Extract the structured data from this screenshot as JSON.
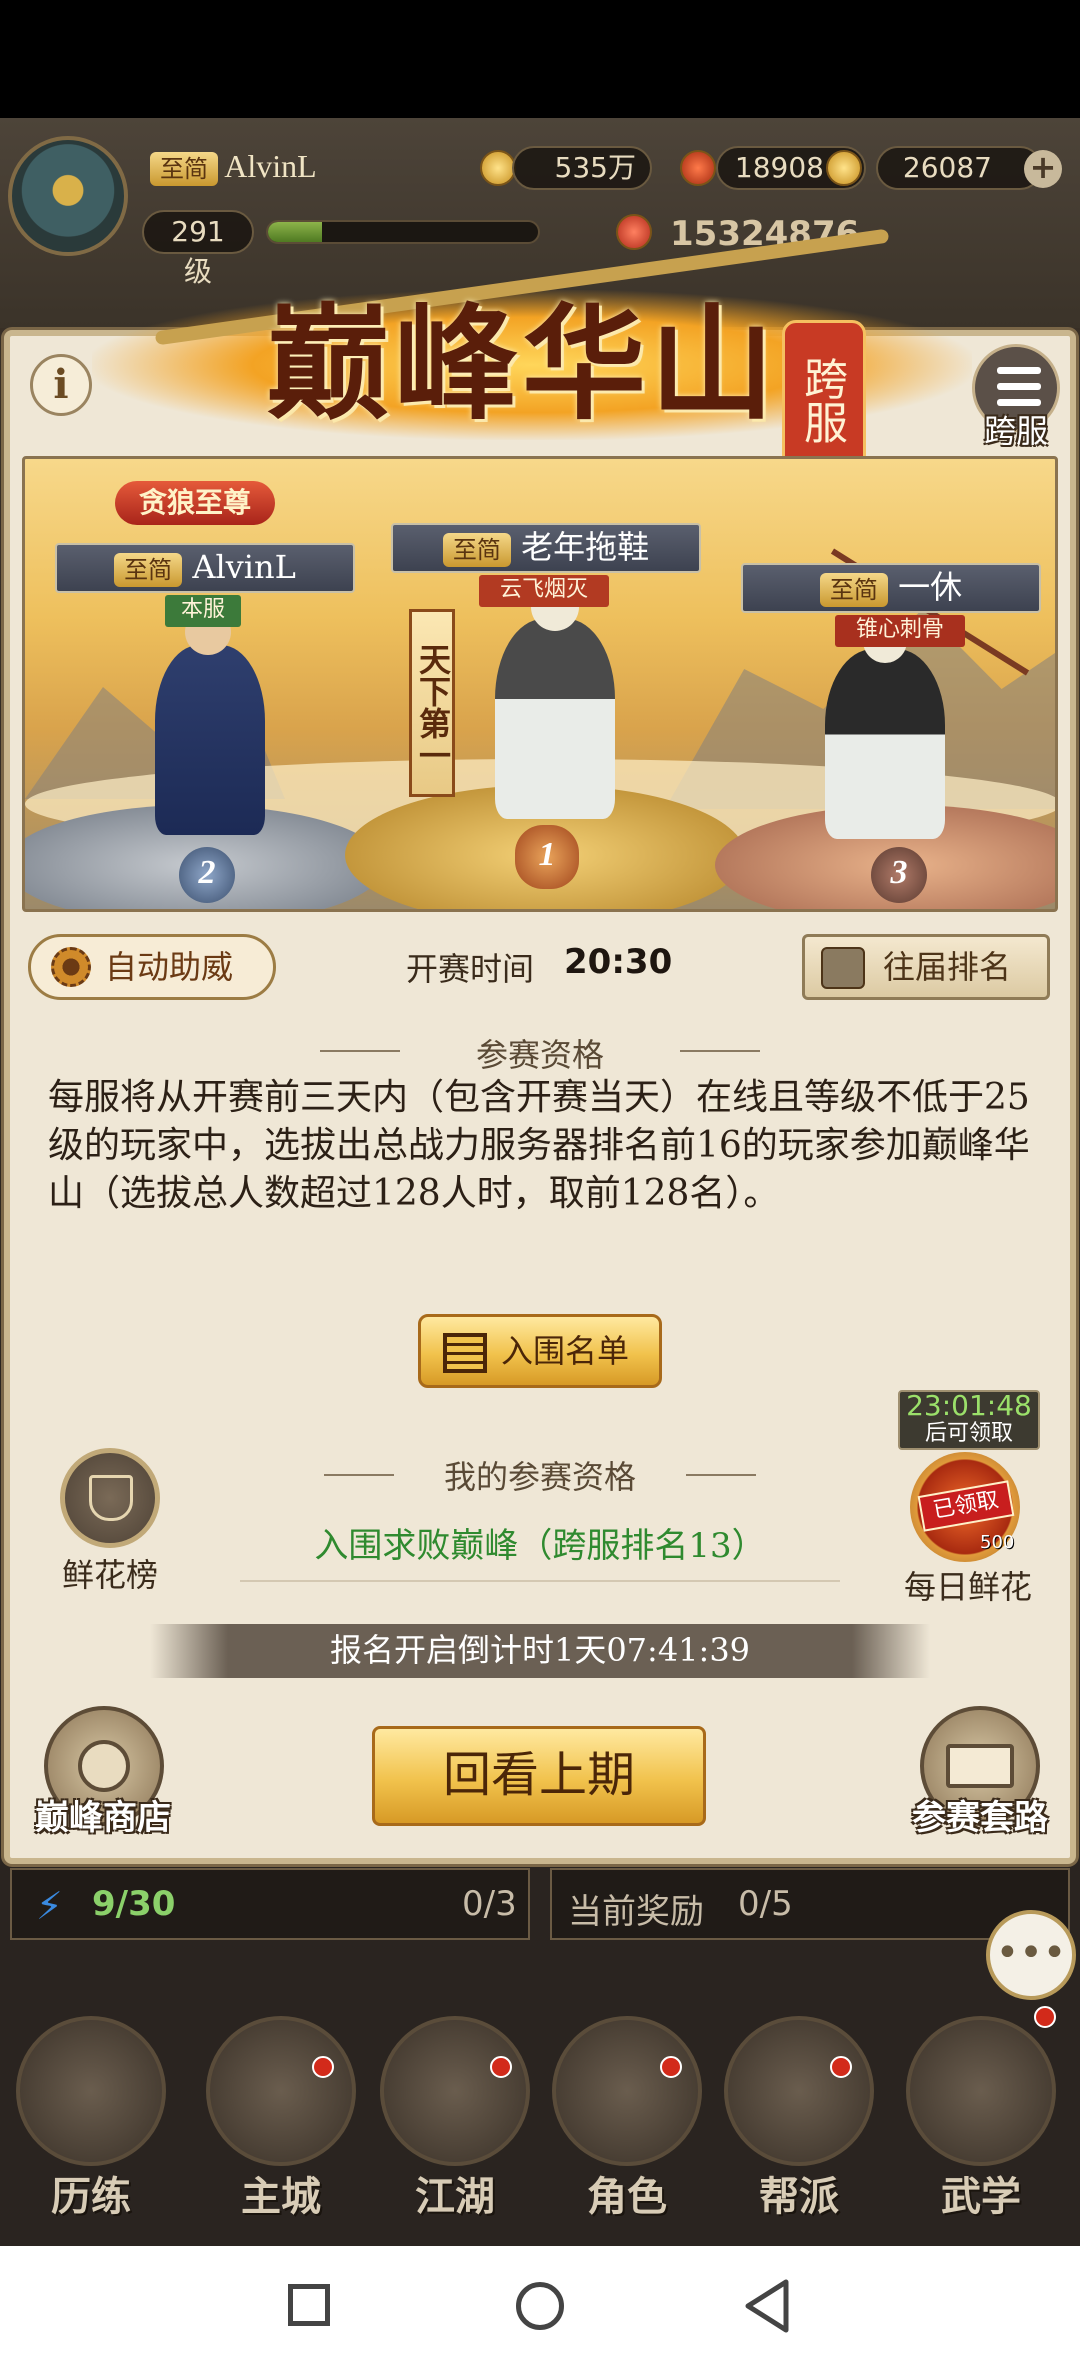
{
  "top_bar": {
    "vip_tag": "至简",
    "player_name": "AlvinL",
    "level": "291级",
    "level_progress": 0.2,
    "coins": "535万",
    "tokens": "18908",
    "gold": "26087",
    "power": "15324876"
  },
  "header": {
    "title": "巅峰华山",
    "seal_text": "跨服",
    "info_label": "i",
    "cross_server_label": "跨服"
  },
  "podium": {
    "banner_text": "天下第一",
    "title_badge": "贪狼至尊",
    "rank1": {
      "tag": "至简",
      "name": "老年拖鞋",
      "sub": "云飞烟灭",
      "rank": "1"
    },
    "rank2": {
      "tag": "至简",
      "name": "AlvinL",
      "sub": "本服",
      "rank": "2"
    },
    "rank3": {
      "tag": "至简",
      "name": "一休",
      "sub": "锥心刺骨",
      "rank": "3"
    }
  },
  "controls": {
    "auto_cheer_label": "自动助威",
    "start_time_label": "开赛时间",
    "start_time_value": "20:30",
    "past_ranking_label": "往届排名"
  },
  "eligibility": {
    "section_title": "参赛资格",
    "description": "每服将从开赛前三天内（包含开赛当天）在线且等级不低于25级的玩家中，选拔出总战力服务器排名前16的玩家参加巅峰华山（选拔总人数超过128人时，取前128名）。",
    "shortlist_label": "入围名单"
  },
  "my_status": {
    "section_title": "我的参赛资格",
    "status_text": "入围求败巅峰（跨服排名13）",
    "flower_rank_label": "鲜花榜",
    "daily_flower_timer": "23:01:48",
    "daily_flower_sub": "后可领取",
    "daily_flower_stamp": "已领取",
    "daily_flower_count": "500",
    "daily_flower_label": "每日鲜花",
    "countdown": "报名开启倒计时1天07:41:39"
  },
  "footer": {
    "shop_label": "巅峰商店",
    "replay_label": "回看上期",
    "tactics_label": "参赛套路"
  },
  "background_strip": {
    "energy": "9/30",
    "sub_count": "0/3",
    "reward_label": "当前奖励",
    "reward_count": "0/5"
  },
  "bottom_nav": [
    {
      "label": "历练"
    },
    {
      "label": "主城"
    },
    {
      "label": "江湖"
    },
    {
      "label": "角色"
    },
    {
      "label": "帮派"
    },
    {
      "label": "武学"
    }
  ],
  "colors": {
    "panel_bg": "#efe7d6",
    "accent_green": "#2f8a2f",
    "title_red": "#5a1e0a"
  }
}
